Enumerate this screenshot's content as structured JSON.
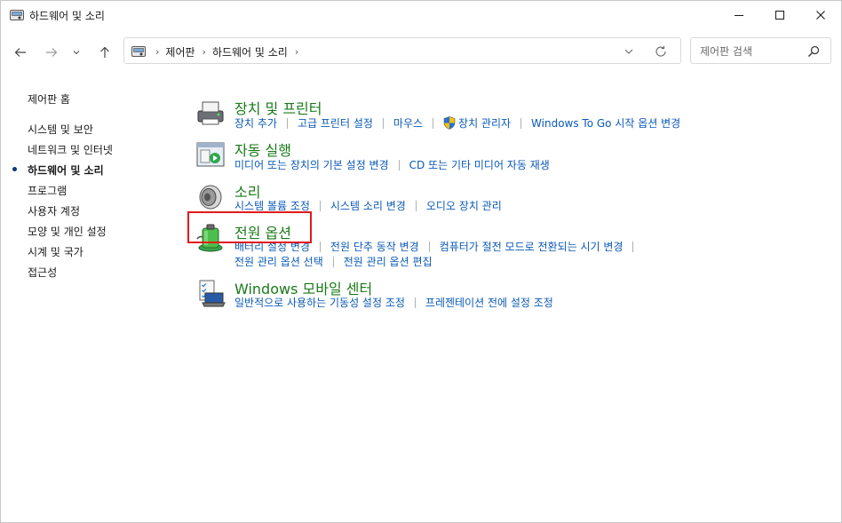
{
  "window": {
    "title": "하드웨어 및 소리"
  },
  "address": {
    "crumbs": [
      "제어판",
      "하드웨어 및 소리"
    ]
  },
  "search": {
    "placeholder": "제어판 검색"
  },
  "sidebar": {
    "home": "제어판 홈",
    "items": [
      {
        "label": "시스템 및 보안",
        "current": false
      },
      {
        "label": "네트워크 및 인터넷",
        "current": false
      },
      {
        "label": "하드웨어 및 소리",
        "current": true
      },
      {
        "label": "프로그램",
        "current": false
      },
      {
        "label": "사용자 계정",
        "current": false
      },
      {
        "label": "모양 및 개인 설정",
        "current": false
      },
      {
        "label": "시계 및 국가",
        "current": false
      },
      {
        "label": "접근성",
        "current": false
      }
    ]
  },
  "categories": [
    {
      "title": "장치 및 프린터",
      "icon": "printer-icon",
      "links": [
        [
          "장치 추가",
          "고급 프린터 설정",
          "마우스",
          "장치 관리자",
          "Windows To Go 시작 옵션 변경"
        ]
      ]
    },
    {
      "title": "자동 실행",
      "icon": "autoplay-icon",
      "links": [
        [
          "미디어 또는 장치의 기본 설정 변경",
          "CD 또는 기타 미디어 자동 재생"
        ]
      ]
    },
    {
      "title": "소리",
      "icon": "speaker-icon",
      "links": [
        [
          "시스템 볼륨 조정",
          "시스템 소리 변경",
          "오디오 장치 관리"
        ]
      ]
    },
    {
      "title": "전원 옵션",
      "icon": "battery-icon",
      "links": [
        [
          "배터리 설정 변경",
          "전원 단추 동작 변경",
          "컴퓨터가 절전 모드로 전환되는 시기 변경"
        ],
        [
          "전원 관리 옵션 선택",
          "전원 관리 옵션 편집"
        ]
      ]
    },
    {
      "title": "Windows 모바일 센터",
      "icon": "mobility-center-icon",
      "links": [
        [
          "일반적으로 사용하는 기동성 설정 조정",
          "프레젠테이션 전에 설정 조정"
        ]
      ]
    }
  ],
  "colors": {
    "category_title": "#1a7a1a",
    "link": "#0b5ab8",
    "highlight": "#e21a1a"
  }
}
